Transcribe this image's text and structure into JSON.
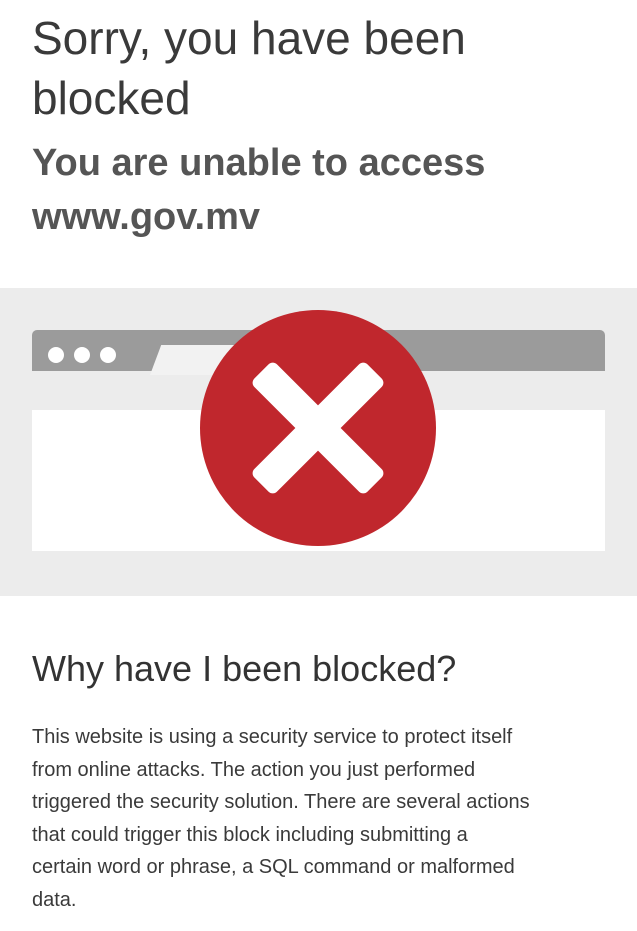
{
  "page": {
    "title_line1": "Sorry, you have been",
    "title_line2": "blocked",
    "subtitle_line1": "You are unable to access",
    "subtitle_line2": "www.gov.mv"
  },
  "illustration": {
    "icon": "error-x-icon",
    "colors": {
      "error_red": "#c0272d",
      "band_gray": "#ececec",
      "browser_bar": "#9b9b9b"
    }
  },
  "why": {
    "heading": "Why have I been blocked?",
    "body_lines": [
      "This website is using a security service to protect itself",
      "from online attacks. The action you just performed",
      "triggered the security solution. There are several actions",
      "that could trigger this block including submitting a",
      "certain word or phrase, a SQL command or malformed",
      "data."
    ]
  }
}
